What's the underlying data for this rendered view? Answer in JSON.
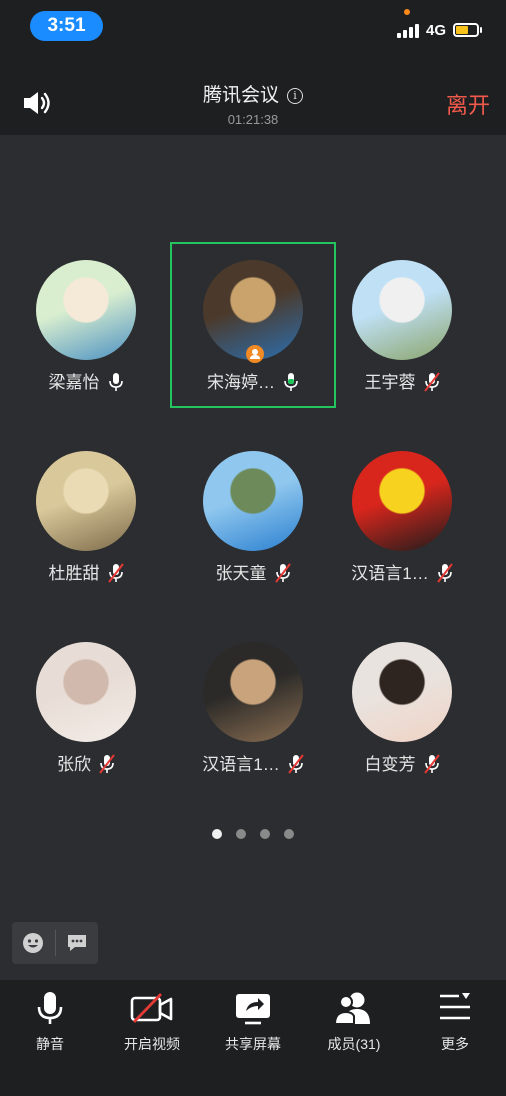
{
  "status_bar": {
    "time": "3:51",
    "network": "4G"
  },
  "header": {
    "title": "腾讯会议",
    "duration": "01:21:38",
    "leave_label": "离开"
  },
  "participants": [
    {
      "name": "梁嘉怡",
      "mic": "on",
      "colors": [
        "#d9eecf",
        "#f5e9d7",
        "#4a90c2"
      ]
    },
    {
      "name": "宋海婷…",
      "mic": "on-active",
      "active": true,
      "colors": [
        "#4b3a2c",
        "#c9a36b",
        "#2c6fb0"
      ]
    },
    {
      "name": "王宇蓉",
      "mic": "muted",
      "colors": [
        "#bfe0f5",
        "#f0f0f0",
        "#8aa46a"
      ]
    },
    {
      "name": "杜胜甜",
      "mic": "muted",
      "colors": [
        "#d9c89a",
        "#eadbb5",
        "#7d6b4a"
      ]
    },
    {
      "name": "张天童",
      "mic": "muted",
      "colors": [
        "#8fc7ee",
        "#6c8a5a",
        "#2a7fd0"
      ]
    },
    {
      "name": "汉语言1…",
      "mic": "muted",
      "colors": [
        "#d9261c",
        "#f7d21e",
        "#1c1c1c"
      ]
    },
    {
      "name": "张欣",
      "mic": "muted",
      "colors": [
        "#e8ddd6",
        "#d1b9ad",
        "#f3ece7"
      ]
    },
    {
      "name": "汉语言1…",
      "mic": "muted",
      "colors": [
        "#2b2a28",
        "#c9a37c",
        "#8a6e52"
      ]
    },
    {
      "name": "白变芳",
      "mic": "muted",
      "colors": [
        "#e9e3df",
        "#2e2420",
        "#f0d3c4"
      ]
    }
  ],
  "toolbar": {
    "mute_label": "静音",
    "video_label": "开启视频",
    "share_label": "共享屏幕",
    "members_label": "成员(31)",
    "more_label": "更多"
  },
  "colors": {
    "accent_green": "#22c55e",
    "leave_red": "#f15a4a",
    "time_blue": "#1a8cff"
  }
}
